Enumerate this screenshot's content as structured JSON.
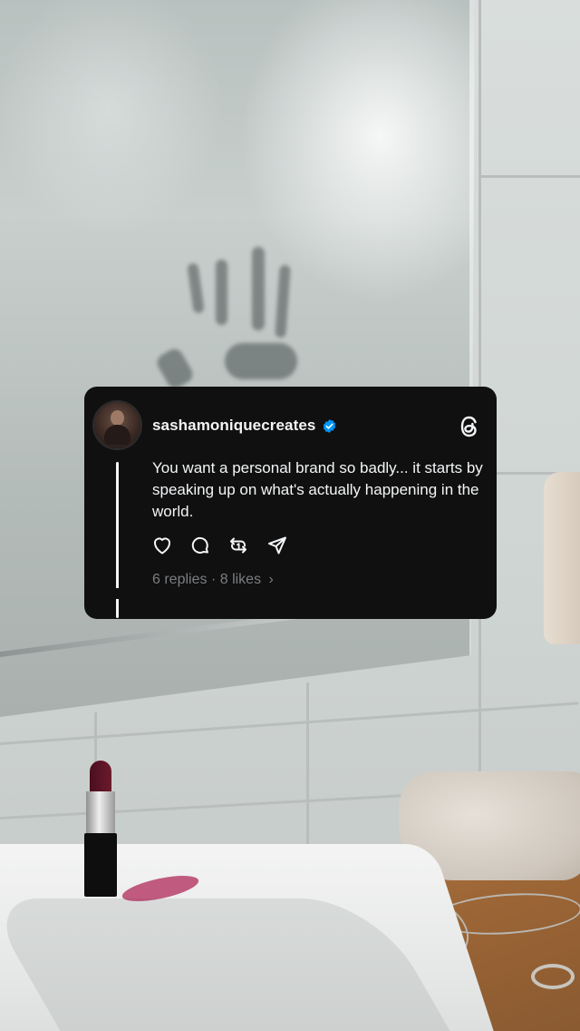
{
  "post": {
    "username": "sashamoniquecreates",
    "verified": true,
    "text": "You want a personal brand so badly... it starts by speaking up on what's actually happening in the world.",
    "replies": "6 replies",
    "separator": "·",
    "likes": "8 likes",
    "chevron": "›"
  },
  "icons": {
    "like": "heart-icon",
    "reply": "comment-icon",
    "repost": "repost-icon",
    "share": "send-icon",
    "brand": "threads-logo-icon",
    "badge": "verified-badge-icon"
  },
  "colors": {
    "card_background": "#101010",
    "text_primary": "#f3f5f7",
    "text_secondary": "#7b7e82",
    "verified_blue": "#0095f6"
  }
}
